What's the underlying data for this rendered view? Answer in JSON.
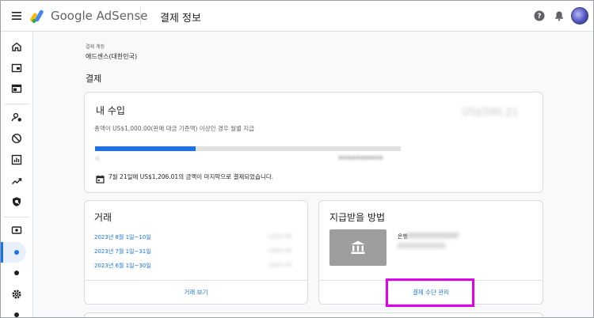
{
  "app": {
    "brand": "Google AdSense",
    "page_title": "결제 정보"
  },
  "header": {
    "menu_icon": "menu-icon",
    "help_icon": "help-icon",
    "bell_icon": "notifications-icon",
    "avatar": "avatar"
  },
  "sidebar": {
    "icons": [
      "home-icon",
      "ads-icon",
      "sites-icon",
      "account-access-icon",
      "block-icon",
      "reports-icon",
      "optimization-icon",
      "policy-icon",
      "payments-icon",
      "payments-info-dot",
      "payments-sub-dot",
      "settings-icon",
      "more-dot"
    ]
  },
  "account": {
    "label": "결제 계정",
    "name": "애드센스(대한민국)"
  },
  "section_title": "결제",
  "earnings": {
    "title": "내 수입",
    "amount": "US$590.21",
    "description": "총액이 US$1,000.00(판매 대금 기준액) 이상인 경우 월별 지급",
    "progress_fraction": 0.33,
    "progress_label": "지",
    "note": "7월 21일에 US$1,206.01의 금액이 마지막으로 결제되었습니다."
  },
  "transactions": {
    "title": "거래",
    "rows": [
      {
        "period": "2023년 8월 1일~10일",
        "amount": "US$0.00"
      },
      {
        "period": "2023년 7월 1일~31일",
        "amount": "US$0.00"
      },
      {
        "period": "2023년 6월 1일~30일",
        "amount": "US$0.00"
      }
    ],
    "link": "거래 보기"
  },
  "payment_method": {
    "title": "지급받을 방법",
    "bank_label": "은행",
    "link": "결제 수단 관리"
  },
  "colors": {
    "accent": "#1a73e8",
    "highlight": "#e100e9",
    "bank_box": "#9e9e9e"
  }
}
